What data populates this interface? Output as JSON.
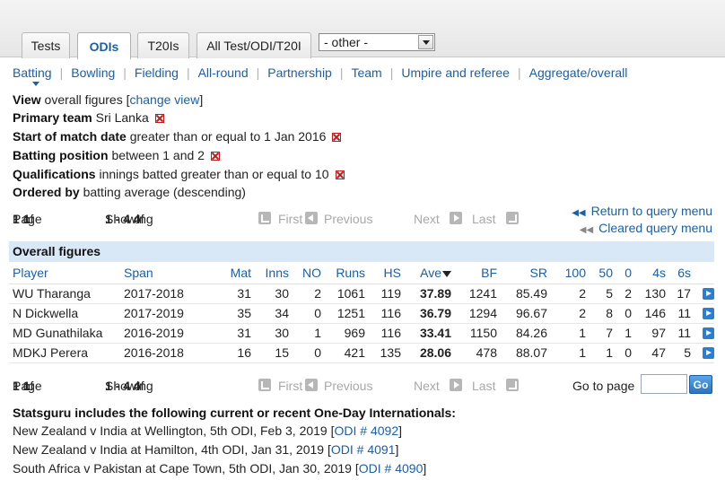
{
  "tabs": [
    {
      "label": "Tests",
      "active": false
    },
    {
      "label": "ODIs",
      "active": true
    },
    {
      "label": "T20Is",
      "active": false
    },
    {
      "label": "All Test/ODI/T20I",
      "active": false
    }
  ],
  "other_select": {
    "selected": "- other -"
  },
  "subnav": [
    "Batting",
    "Bowling",
    "Fielding",
    "All-round",
    "Partnership",
    "Team",
    "Umpire and referee",
    "Aggregate/overall"
  ],
  "criteria": {
    "view": {
      "label": "View",
      "value": "overall figures [",
      "link": "change view",
      "close": "]"
    },
    "primary_team": {
      "label": "Primary team",
      "value": "Sri Lanka"
    },
    "start_date": {
      "label": "Start of match date",
      "value": "greater than or equal to 1 Jan 2016"
    },
    "batting_position": {
      "label": "Batting position",
      "value": "between 1 and 2"
    },
    "qualifications": {
      "label": "Qualifications",
      "value": "innings batted greater than or equal to 10"
    },
    "ordered": {
      "label": "Ordered by",
      "value": "batting average (descending)"
    }
  },
  "pager": {
    "page_word": "Page",
    "page": "1",
    "of_word": "of",
    "total_pages": "1",
    "showing_word": "Showing",
    "range": "1 - 4",
    "total": "4",
    "first": "First",
    "previous": "Previous",
    "next": "Next",
    "last": "Last",
    "goto_label": "Go to page",
    "go_button": "Go"
  },
  "query_links": {
    "return": "Return to query menu",
    "cleared": "Cleared query menu"
  },
  "results_title": "Overall figures",
  "columns": [
    "Player",
    "Span",
    "Mat",
    "Inns",
    "NO",
    "Runs",
    "HS",
    "Ave",
    "BF",
    "SR",
    "100",
    "50",
    "0",
    "4s",
    "6s"
  ],
  "rows": [
    [
      "WU Tharanga",
      "2017-2018",
      "31",
      "30",
      "2",
      "1061",
      "119",
      "37.89",
      "1241",
      "85.49",
      "2",
      "5",
      "2",
      "130",
      "17"
    ],
    [
      "N Dickwella",
      "2017-2019",
      "35",
      "34",
      "0",
      "1251",
      "116",
      "36.79",
      "1294",
      "96.67",
      "2",
      "8",
      "0",
      "146",
      "11"
    ],
    [
      "MD Gunathilaka",
      "2016-2019",
      "31",
      "30",
      "1",
      "969",
      "116",
      "33.41",
      "1150",
      "84.26",
      "1",
      "7",
      "1",
      "97",
      "11"
    ],
    [
      "MDKJ Perera",
      "2016-2018",
      "16",
      "15",
      "0",
      "421",
      "135",
      "28.06",
      "478",
      "88.07",
      "1",
      "1",
      "0",
      "47",
      "5"
    ]
  ],
  "notes": {
    "title": "Statsguru includes the following current or recent One-Day Internationals:",
    "items": [
      {
        "text": "New Zealand v India at Wellington, 5th ODI, Feb 3, 2019 [",
        "link": "ODI # 4092",
        "close": "]"
      },
      {
        "text": "New Zealand v India at Hamilton, 4th ODI, Jan 31, 2019 [",
        "link": "ODI # 4091",
        "close": "]"
      },
      {
        "text": "South Africa v Pakistan at Cape Town, 5th ODI, Jan 30, 2019 [",
        "link": "ODI # 4090",
        "close": "]"
      }
    ]
  }
}
